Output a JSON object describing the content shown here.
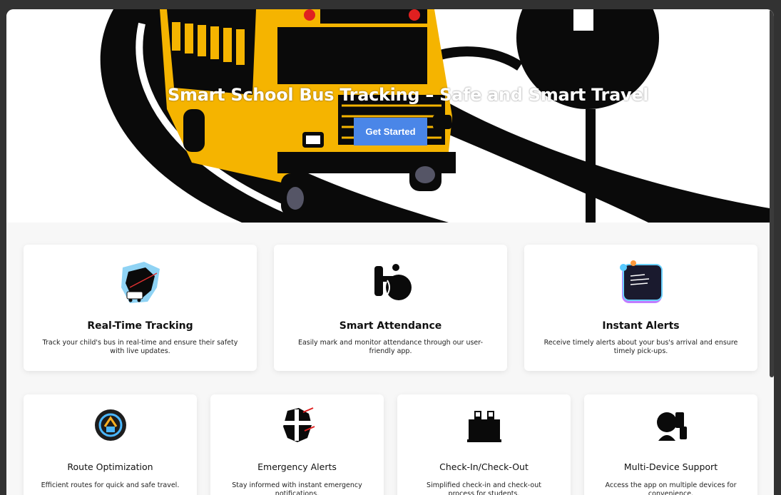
{
  "hero": {
    "title": "Smart School Bus Tracking – Safe and Smart Travel",
    "cta_label": "Get Started"
  },
  "features_top": [
    {
      "title": "Real-Time Tracking",
      "desc": "Track your child's bus in real-time and ensure their safety with live updates.",
      "icon": "map-tracking-icon"
    },
    {
      "title": "Smart Attendance",
      "desc": "Easily mark and monitor attendance through our user-friendly app.",
      "icon": "attendance-icon"
    },
    {
      "title": "Instant Alerts",
      "desc": "Receive timely alerts about your bus's arrival and ensure timely pick-ups.",
      "icon": "alert-screen-icon"
    }
  ],
  "features_bottom": [
    {
      "title": "Route Optimization",
      "desc": "Efficient routes for quick and safe travel.",
      "icon": "route-icon"
    },
    {
      "title": "Emergency Alerts",
      "desc": "Stay informed with instant emergency notifications.",
      "icon": "emergency-icon"
    },
    {
      "title": "Check-In/Check-Out",
      "desc": "Simplified check-in and check-out process for students.",
      "icon": "checkin-kiosk-icon"
    },
    {
      "title": "Multi-Device Support",
      "desc": "Access the app on multiple devices for convenience.",
      "icon": "multi-device-icon"
    }
  ],
  "colors": {
    "accent": "#4a86e8",
    "bus_yellow": "#f5b400",
    "background": "#f7f7f7"
  }
}
